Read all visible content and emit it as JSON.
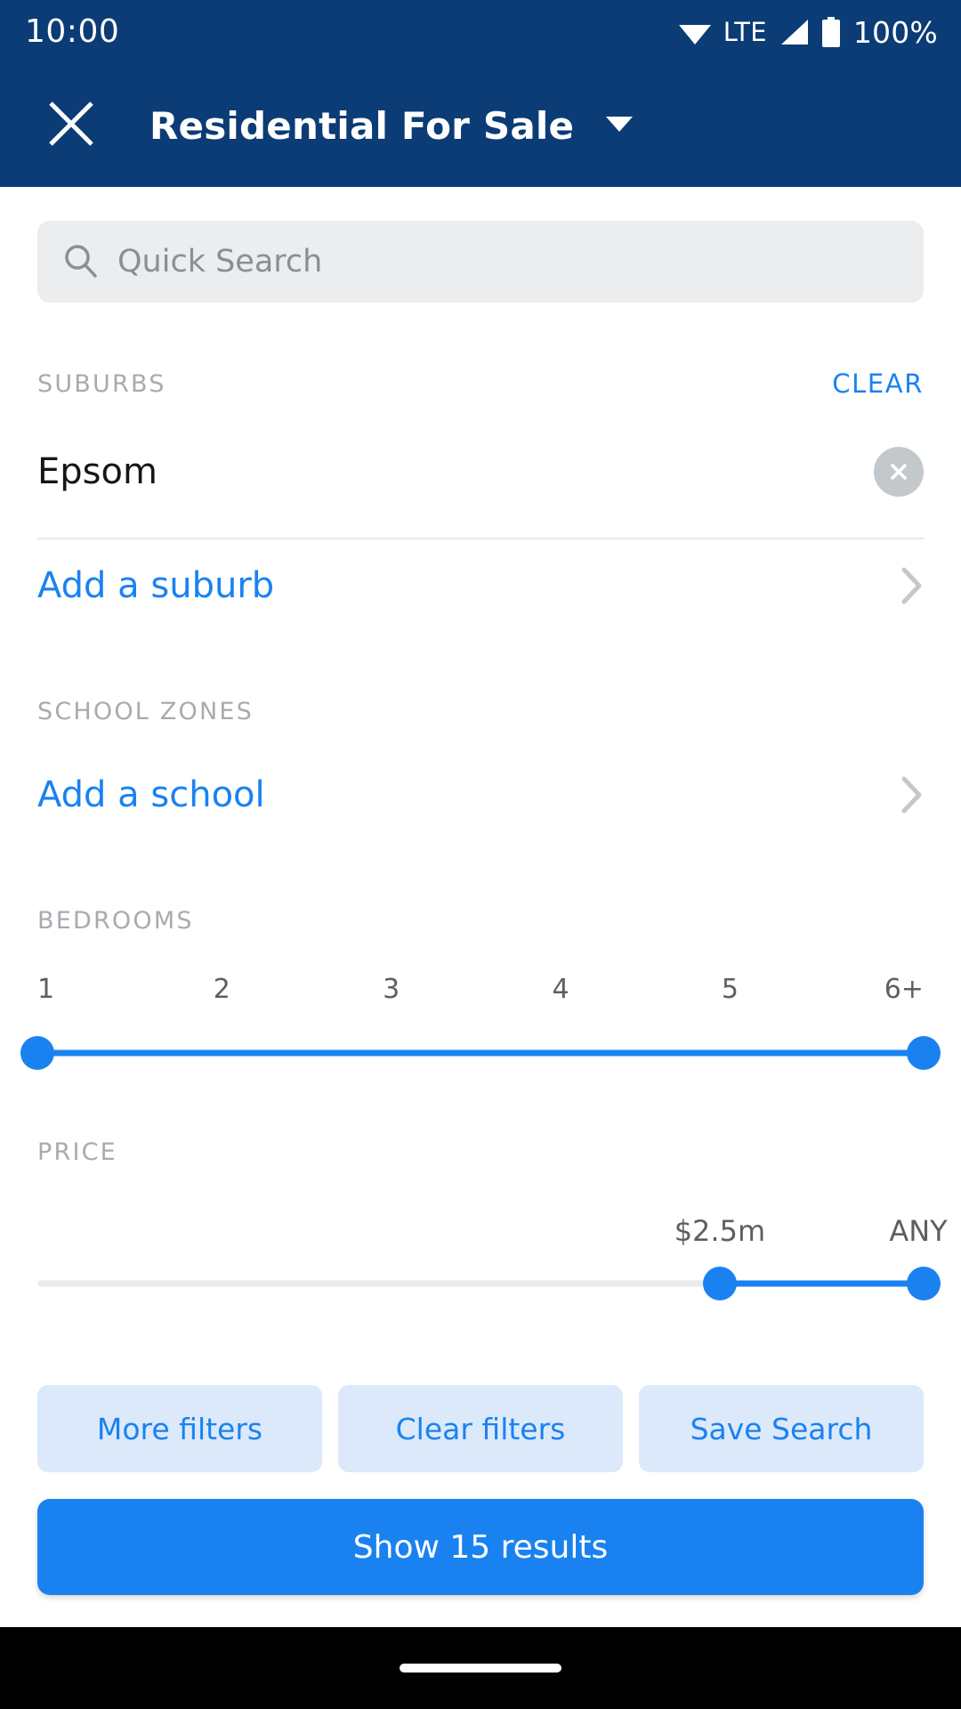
{
  "status_bar": {
    "time": "10:00",
    "network_label": "LTE",
    "battery_label": "100%",
    "icons": [
      "wifi-icon",
      "signal-icon",
      "battery-icon"
    ]
  },
  "header": {
    "close_icon": "close-icon",
    "title": "Residential For Sale",
    "dropdown_icon": "chevron-down-icon",
    "background_color": "#0b3c75"
  },
  "search": {
    "icon": "search-icon",
    "placeholder": "Quick Search",
    "value": ""
  },
  "suburbs": {
    "label": "SUBURBS",
    "clear_label": "CLEAR",
    "selected": [
      {
        "name": "Epsom",
        "remove_icon": "close-circle-icon"
      }
    ],
    "add_label": "Add a suburb",
    "add_chevron": "chevron-right-icon"
  },
  "school_zones": {
    "label": "SCHOOL ZONES",
    "add_label": "Add a school",
    "add_chevron": "chevron-right-icon"
  },
  "bedrooms": {
    "label": "BEDROOMS",
    "ticks": [
      "1",
      "2",
      "3",
      "4",
      "5",
      "6+"
    ],
    "min_percent": 0,
    "max_percent": 100,
    "min_value": "1",
    "max_value": "6+"
  },
  "price": {
    "label": "PRICE",
    "min_value": "$2.5m",
    "max_value": "ANY",
    "min_percent": 77,
    "max_percent": 100
  },
  "footer": {
    "more_filters_label": "More filters",
    "clear_filters_label": "Clear filters",
    "save_search_label": "Save Search",
    "cta_label": "Show 15 results"
  },
  "colors": {
    "header_blue": "#0b3c75",
    "accent_blue": "#1a82f0",
    "pill_blue_bg": "#dce9fb",
    "muted_gray": "#a7abaf",
    "search_bg": "#ebedef"
  }
}
